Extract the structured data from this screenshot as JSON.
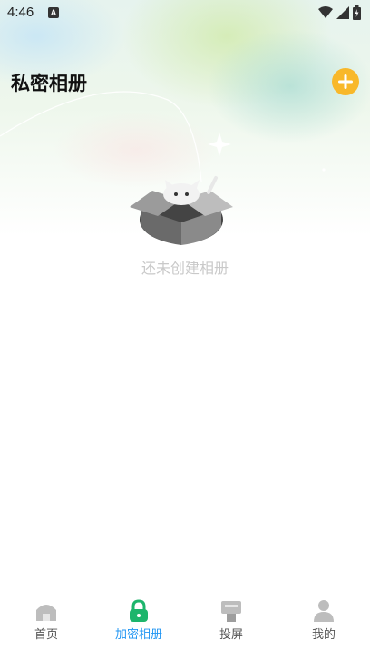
{
  "status_bar": {
    "time": "4:46",
    "notification_icon": "A"
  },
  "header": {
    "title": "私密相册",
    "add_icon": "plus-icon",
    "accent_color": "#f8b82a"
  },
  "empty_state": {
    "message": "还未创建相册",
    "illustration": "empty-box-cat"
  },
  "tab_bar": {
    "active_color": "#2196f3",
    "items": [
      {
        "label": "首页",
        "icon": "home-icon"
      },
      {
        "label": "加密相册",
        "icon": "lock-icon",
        "active": true
      },
      {
        "label": "投屏",
        "icon": "cast-icon"
      },
      {
        "label": "我的",
        "icon": "person-icon"
      }
    ]
  }
}
